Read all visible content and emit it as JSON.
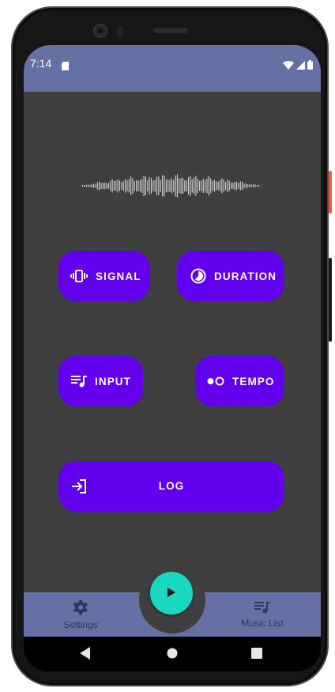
{
  "status_bar": {
    "time": "7:14",
    "icons": [
      "sd-card-icon",
      "wifi-icon",
      "cellular-signal-icon",
      "battery-icon"
    ],
    "color": "#6571a5"
  },
  "waveform": {
    "icon": "sound-waveform-icon"
  },
  "buttons": {
    "signal": {
      "label": "SIGNAL",
      "icon": "vibration-icon"
    },
    "duration": {
      "label": "DURATION",
      "icon": "timelapse-icon"
    },
    "input": {
      "label": "INPUT",
      "icon": "queue-music-icon"
    },
    "tempo": {
      "label": "TEMPO",
      "icon": "dots-toggle-icon"
    },
    "log": {
      "label": "LOG",
      "icon": "login-icon"
    }
  },
  "bottom_nav": {
    "settings": {
      "label": "Settings",
      "icon": "gear-icon"
    },
    "music_list": {
      "label": "Music List",
      "icon": "queue-music-icon"
    }
  },
  "fab": {
    "icon": "play-icon"
  },
  "system_nav": [
    "back-icon",
    "home-icon",
    "recents-icon"
  ],
  "colors": {
    "primary_button": "#6200ee",
    "fab": "#1ad7c2",
    "bars": "#6571a5",
    "background": "#3f3f3f",
    "nav_text": "#2f375a"
  }
}
